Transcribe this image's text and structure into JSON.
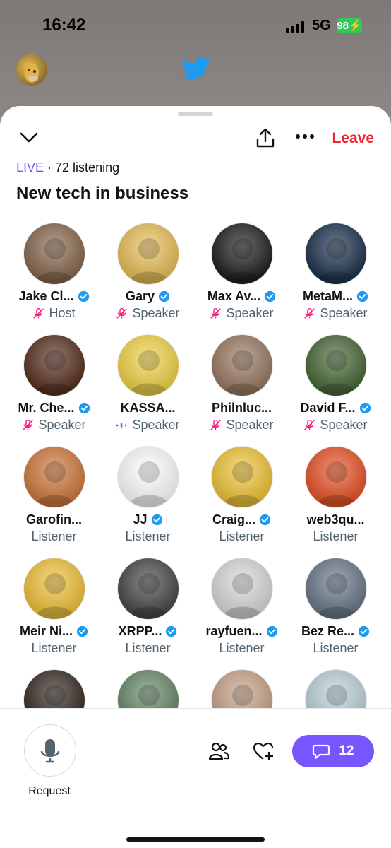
{
  "status_bar": {
    "time": "16:42",
    "network": "5G",
    "battery": "98"
  },
  "space": {
    "live_label": "LIVE",
    "separator": " · ",
    "listening": "72 listening",
    "title": "New tech in business",
    "leave_label": "Leave"
  },
  "participants": [
    {
      "name": "Jake Cl...",
      "role": "Host",
      "verified": true,
      "role_icon": "mic-off-icon",
      "color": "#8a6a50"
    },
    {
      "name": "Gary",
      "role": "Speaker",
      "verified": true,
      "role_icon": "mic-off-icon",
      "color": "#e9c15a"
    },
    {
      "name": "Max Av...",
      "role": "Speaker",
      "verified": true,
      "role_icon": "mic-off-icon",
      "color": "#222222"
    },
    {
      "name": "MetaM...",
      "role": "Speaker",
      "verified": true,
      "role_icon": "mic-off-icon",
      "color": "#1f3550"
    },
    {
      "name": "Mr. Che...",
      "role": "Speaker",
      "verified": true,
      "role_icon": "mic-off-icon",
      "color": "#5a3322"
    },
    {
      "name": "KASSA...",
      "role": "Speaker",
      "verified": false,
      "role_icon": "speaking-icon",
      "color": "#f2d44a"
    },
    {
      "name": "Philnluc...",
      "role": "Speaker",
      "verified": false,
      "role_icon": "mic-off-icon",
      "color": "#9b7b63"
    },
    {
      "name": "David F...",
      "role": "Speaker",
      "verified": true,
      "role_icon": "mic-off-icon",
      "color": "#4a6a3a"
    },
    {
      "name": "Garofin...",
      "role": "Listener",
      "verified": false,
      "role_icon": "",
      "color": "#d07a40"
    },
    {
      "name": "JJ",
      "role": "Listener",
      "verified": true,
      "role_icon": "",
      "color": "#ffffff"
    },
    {
      "name": "Craig...",
      "role": "Listener",
      "verified": true,
      "role_icon": "",
      "color": "#f0c63a"
    },
    {
      "name": "web3qu...",
      "role": "Listener",
      "verified": false,
      "role_icon": "",
      "color": "#e8552a"
    },
    {
      "name": "Meir Ni...",
      "role": "Listener",
      "verified": true,
      "role_icon": "",
      "color": "#f0c33c"
    },
    {
      "name": "XRPP...",
      "role": "Listener",
      "verified": true,
      "role_icon": "",
      "color": "#4a4a4a"
    },
    {
      "name": "rayfuen...",
      "role": "Listener",
      "verified": true,
      "role_icon": "",
      "color": "#d9d9d9"
    },
    {
      "name": "Bez Re...",
      "role": "Listener",
      "verified": true,
      "role_icon": "",
      "color": "#6b7a8a"
    },
    {
      "name": "",
      "role": "",
      "verified": false,
      "role_icon": "",
      "color": "#3a2e28"
    },
    {
      "name": "",
      "role": "",
      "verified": false,
      "role_icon": "",
      "color": "#6a8a6a"
    },
    {
      "name": "",
      "role": "",
      "verified": false,
      "role_icon": "",
      "color": "#c9a58a"
    },
    {
      "name": "",
      "role": "",
      "verified": false,
      "role_icon": "",
      "color": "#bcd3d8"
    }
  ],
  "bottom_bar": {
    "request_label": "Request",
    "chat_count": "12"
  },
  "colors": {
    "accent": "#7856ff",
    "leave": "#f4212e",
    "verified": "#1d9bf0",
    "mic_off": "#f91880"
  }
}
